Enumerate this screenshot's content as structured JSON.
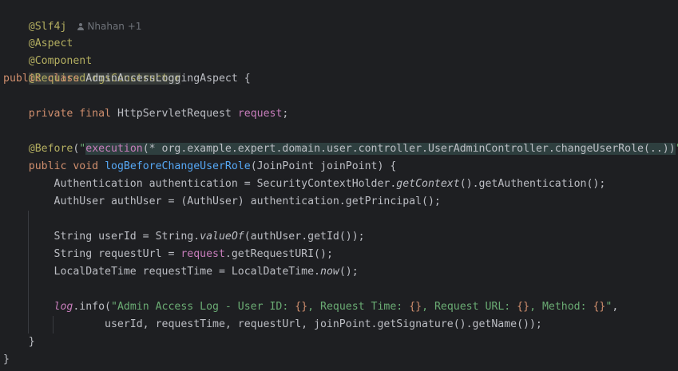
{
  "author_hint": {
    "icon": "person-icon",
    "text": "Nhahan +1"
  },
  "code": {
    "l1": {
      "slf4j": "@Slf4j"
    },
    "l2": {
      "aspect": "@Aspect"
    },
    "l3": {
      "component": "@Component"
    },
    "l4": {
      "required_args": "@RequiredArgsConstructor"
    },
    "l5": {
      "public": "public",
      "class": "class",
      "name": "AdminAccessLoggingAspect",
      "brace": "{"
    },
    "l6": {
      "private": "private",
      "final": "final",
      "type": "HttpServletRequest",
      "field": "request",
      "semi": ";"
    },
    "l7": {
      "before": "@Before",
      "open": "(",
      "q1": "\"",
      "execution": "execution",
      "expr": "(* org.example.expert.domain.user.controller.UserAdminController.changeUserRole(..))",
      "q2": "\"",
      "close": ")"
    },
    "l8": {
      "public": "public",
      "void": "void",
      "method": "logBeforeChangeUserRole",
      "params": "(JoinPoint joinPoint) {"
    },
    "l9": {
      "pre": "Authentication authentication = SecurityContextHolder.",
      "get_context": "getContext",
      "post": "().getAuthentication();"
    },
    "l10": {
      "text": "AuthUser authUser = (AuthUser) authentication.getPrincipal();"
    },
    "l11": {
      "pre": "String userId = String.",
      "value_of": "valueOf",
      "post": "(authUser.getId());"
    },
    "l12": {
      "pre": "String requestUrl = ",
      "request": "request",
      "post": ".getRequestURI();"
    },
    "l13": {
      "pre": "LocalDateTime requestTime = LocalDateTime.",
      "now": "now",
      "post": "();"
    },
    "l14": {
      "log": "log",
      "info": ".info(",
      "s1": "\"Admin Access Log - User ID: ",
      "p1": "{}",
      "s2": ", Request Time: ",
      "p2": "{}",
      "s3": ", Request URL: ",
      "p3": "{}",
      "s4": ", Method: ",
      "p4": "{}",
      "s5": "\"",
      "comma": ","
    },
    "l15": {
      "text": "userId, requestTime, requestUrl, joinPoint.getSignature().getName());"
    },
    "l16": {
      "text": "}"
    },
    "l17": {
      "text": "}"
    }
  },
  "colors": {
    "background": "#1e1f22",
    "default_text": "#bcbec4",
    "annotation": "#b3ae60",
    "keyword": "#cf8e6d",
    "field": "#c77dbb",
    "string": "#6aab73",
    "method_decl": "#56a8f5",
    "hint": "#6f737a"
  }
}
